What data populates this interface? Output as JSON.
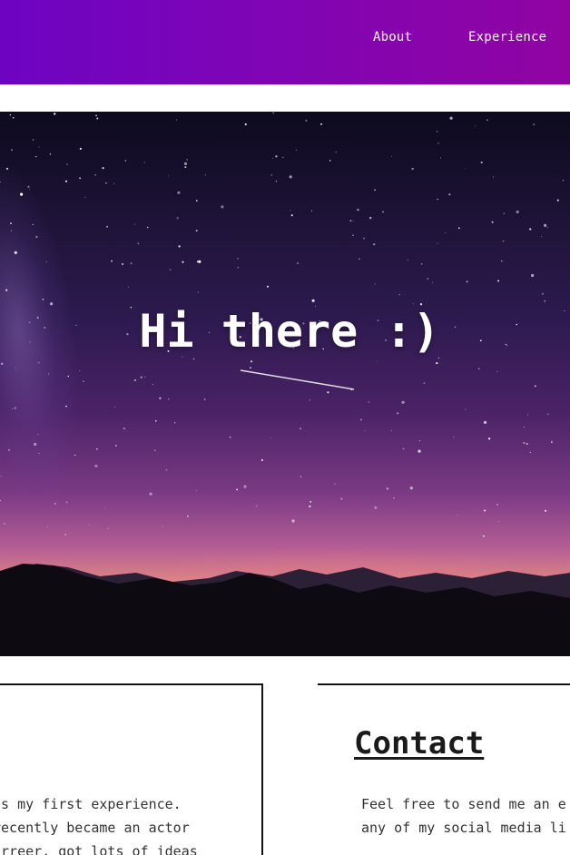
{
  "nav": {
    "items": [
      {
        "label": "About"
      },
      {
        "label": "Experience"
      }
    ]
  },
  "hero": {
    "title": "Hi there :)"
  },
  "about_card": {
    "lines": [
      "is my first experience.",
      "recently became an actor",
      "arreer, got lots of ideas"
    ]
  },
  "contact_card": {
    "title": "Contact",
    "lines": [
      "Feel free to send me an e",
      "any of my social media li"
    ]
  },
  "colors": {
    "header_gradient_start": "#6d04c2",
    "header_gradient_end": "#9004a2",
    "text_dark": "#1a1a1a"
  }
}
